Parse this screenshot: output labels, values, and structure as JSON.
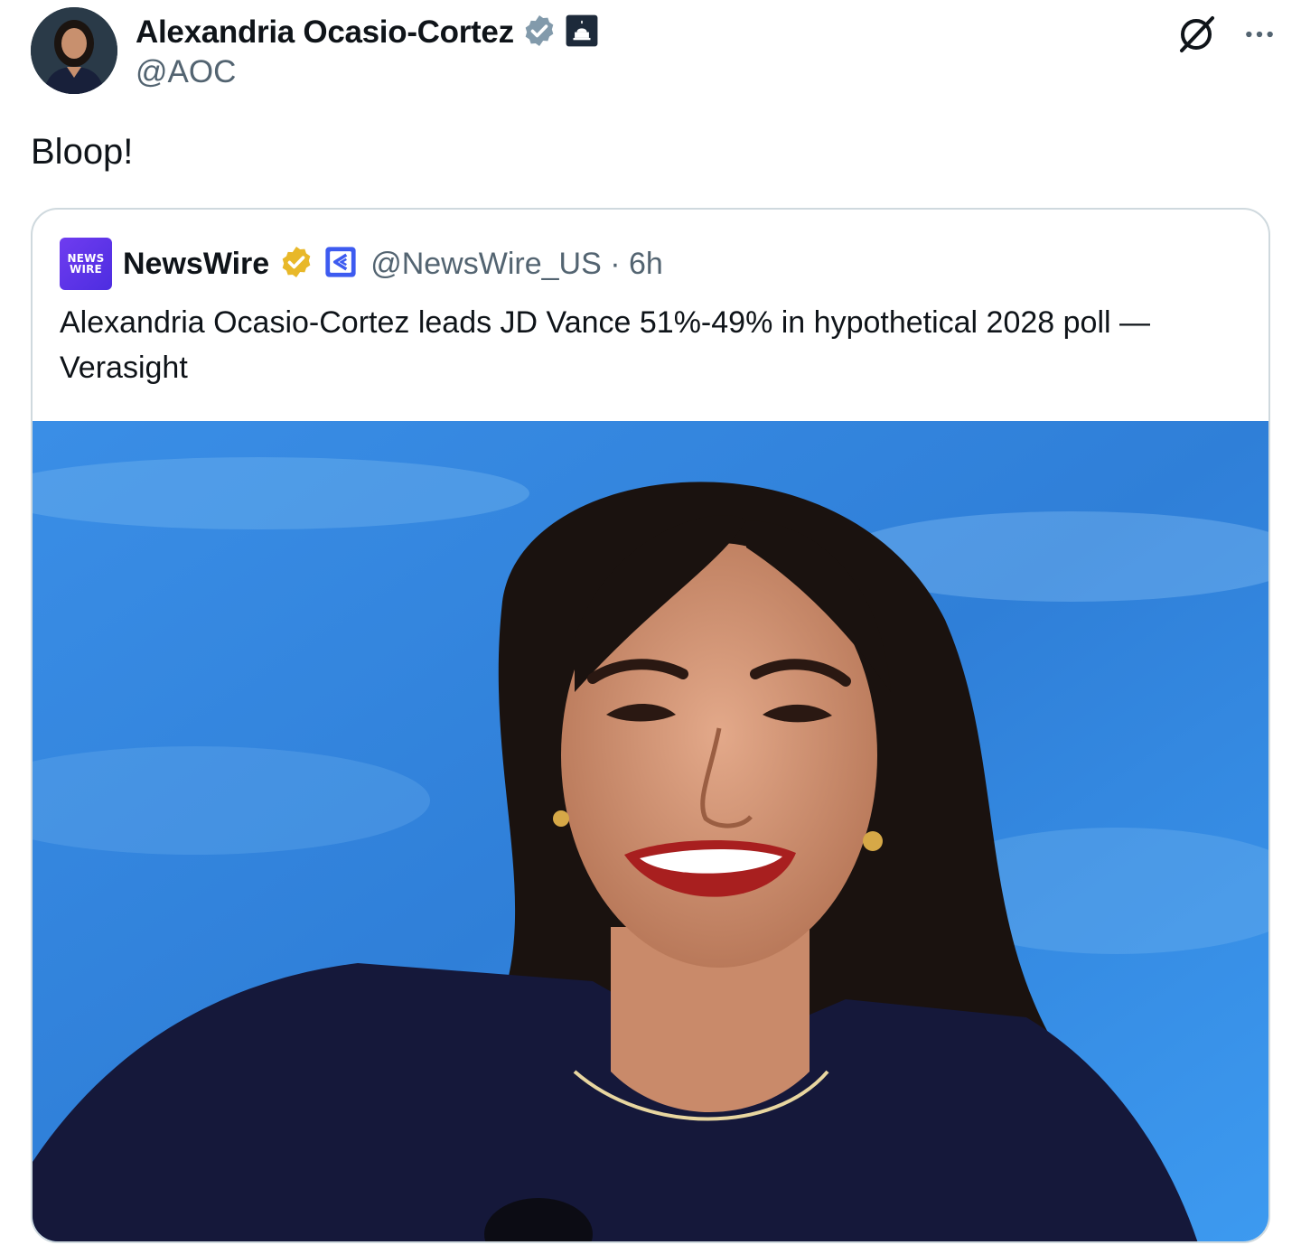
{
  "author": {
    "display_name": "Alexandria Ocasio-Cortez",
    "handle": "@AOC",
    "verified_badge_color": "#829aab",
    "affiliation_badge_icon": "capitol-building-icon"
  },
  "tweet": {
    "text": "Bloop!"
  },
  "header_actions": {
    "grok_icon": "grok-icon",
    "more_icon": "more-options-icon"
  },
  "quoted_tweet": {
    "avatar_text_line1": "NEWS",
    "avatar_text_line2": "WIRE",
    "display_name": "NewsWire",
    "verified_badge_color": "#e8b829",
    "affiliation_badge_icon": "newswire-logo-icon",
    "handle_time": "@NewsWire_US · 6h",
    "text": "Alexandria Ocasio-Cortez leads JD Vance 51%-49% in hypothetical 2028 poll — Verasight",
    "image_icon": "photo-of-smiling-woman"
  },
  "colors": {
    "text_primary": "#0f1419",
    "text_secondary": "#536471",
    "card_border": "#cfd9de",
    "image_background": "#3b8fe0"
  }
}
